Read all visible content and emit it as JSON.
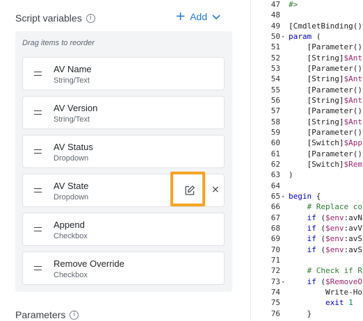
{
  "script_variables": {
    "title": "Script variables",
    "info_icon": "i",
    "add_label": "Add",
    "drag_hint": "Drag items to reorder",
    "items": [
      {
        "name": "AV Name",
        "type": "String/Text"
      },
      {
        "name": "AV Version",
        "type": "String/Text"
      },
      {
        "name": "AV Status",
        "type": "Dropdown"
      },
      {
        "name": "AV State",
        "type": "Dropdown"
      },
      {
        "name": "Append",
        "type": "Checkbox"
      },
      {
        "name": "Remove Override",
        "type": "Checkbox"
      }
    ],
    "close_glyph": "×"
  },
  "parameters": {
    "title": "Parameters",
    "info_icon": "i"
  },
  "editor": {
    "lines": [
      {
        "n": "47",
        "fold": "",
        "parts": [
          {
            "t": "#>",
            "c": "cm"
          }
        ]
      },
      {
        "n": "48",
        "fold": "",
        "parts": []
      },
      {
        "n": "49",
        "fold": "",
        "parts": [
          {
            "t": "[CmdletBinding()",
            "c": ""
          }
        ]
      },
      {
        "n": "50",
        "fold": "▾",
        "parts": [
          {
            "t": "param",
            "c": "kw"
          },
          {
            "t": " (",
            "c": ""
          }
        ]
      },
      {
        "n": "51",
        "fold": "",
        "parts": [
          {
            "t": "    [Parameter()",
            "c": ""
          }
        ]
      },
      {
        "n": "52",
        "fold": "",
        "parts": [
          {
            "t": "    [String]",
            "c": ""
          },
          {
            "t": "$Ant",
            "c": "var"
          }
        ]
      },
      {
        "n": "53",
        "fold": "",
        "parts": [
          {
            "t": "    [Parameter()",
            "c": ""
          }
        ]
      },
      {
        "n": "54",
        "fold": "",
        "parts": [
          {
            "t": "    [String]",
            "c": ""
          },
          {
            "t": "$Ant",
            "c": "var"
          }
        ]
      },
      {
        "n": "55",
        "fold": "",
        "parts": [
          {
            "t": "    [Parameter()",
            "c": ""
          }
        ]
      },
      {
        "n": "56",
        "fold": "",
        "parts": [
          {
            "t": "    [String]",
            "c": ""
          },
          {
            "t": "$Ant",
            "c": "var"
          }
        ]
      },
      {
        "n": "57",
        "fold": "",
        "parts": [
          {
            "t": "    [Parameter()",
            "c": ""
          }
        ]
      },
      {
        "n": "58",
        "fold": "",
        "parts": [
          {
            "t": "    [String]",
            "c": ""
          },
          {
            "t": "$Ant",
            "c": "var"
          }
        ]
      },
      {
        "n": "59",
        "fold": "",
        "parts": [
          {
            "t": "    [Parameter()",
            "c": ""
          }
        ]
      },
      {
        "n": "60",
        "fold": "",
        "parts": [
          {
            "t": "    [Switch]",
            "c": ""
          },
          {
            "t": "$App",
            "c": "var"
          }
        ]
      },
      {
        "n": "61",
        "fold": "",
        "parts": [
          {
            "t": "    [Parameter()",
            "c": ""
          }
        ]
      },
      {
        "n": "62",
        "fold": "",
        "parts": [
          {
            "t": "    [Switch]",
            "c": ""
          },
          {
            "t": "$Rem",
            "c": "var"
          }
        ]
      },
      {
        "n": "63",
        "fold": "",
        "parts": [
          {
            "t": ")",
            "c": ""
          }
        ]
      },
      {
        "n": "64",
        "fold": "",
        "parts": []
      },
      {
        "n": "65",
        "fold": "▾",
        "parts": [
          {
            "t": "begin",
            "c": "kw"
          },
          {
            "t": " {",
            "c": ""
          }
        ]
      },
      {
        "n": "66",
        "fold": "",
        "parts": [
          {
            "t": "    # Replace co",
            "c": "cm"
          }
        ]
      },
      {
        "n": "67",
        "fold": "",
        "parts": [
          {
            "t": "    ",
            "c": ""
          },
          {
            "t": "if",
            "c": "kw"
          },
          {
            "t": " (",
            "c": ""
          },
          {
            "t": "$env",
            "c": "var"
          },
          {
            "t": ":avN",
            "c": ""
          }
        ]
      },
      {
        "n": "68",
        "fold": "",
        "parts": [
          {
            "t": "    ",
            "c": ""
          },
          {
            "t": "if",
            "c": "kw"
          },
          {
            "t": " (",
            "c": ""
          },
          {
            "t": "$env",
            "c": "var"
          },
          {
            "t": ":avV",
            "c": ""
          }
        ]
      },
      {
        "n": "69",
        "fold": "",
        "parts": [
          {
            "t": "    ",
            "c": ""
          },
          {
            "t": "if",
            "c": "kw"
          },
          {
            "t": " (",
            "c": ""
          },
          {
            "t": "$env",
            "c": "var"
          },
          {
            "t": ":avS",
            "c": ""
          }
        ]
      },
      {
        "n": "70",
        "fold": "",
        "parts": [
          {
            "t": "    ",
            "c": ""
          },
          {
            "t": "if",
            "c": "kw"
          },
          {
            "t": " (",
            "c": ""
          },
          {
            "t": "$env",
            "c": "var"
          },
          {
            "t": ":avS",
            "c": ""
          }
        ]
      },
      {
        "n": "71",
        "fold": "",
        "parts": []
      },
      {
        "n": "72",
        "fold": "",
        "parts": [
          {
            "t": "    # Check if R",
            "c": "cm"
          }
        ]
      },
      {
        "n": "73",
        "fold": "▾",
        "parts": [
          {
            "t": "    ",
            "c": ""
          },
          {
            "t": "if",
            "c": "kw"
          },
          {
            "t": " (",
            "c": ""
          },
          {
            "t": "$RemoveO",
            "c": "var"
          }
        ]
      },
      {
        "n": "74",
        "fold": "",
        "parts": [
          {
            "t": "        Write-Ho",
            "c": ""
          }
        ]
      },
      {
        "n": "75",
        "fold": "",
        "parts": [
          {
            "t": "        ",
            "c": ""
          },
          {
            "t": "exit",
            "c": "kw"
          },
          {
            "t": " ",
            "c": ""
          },
          {
            "t": "1",
            "c": "num"
          }
        ]
      },
      {
        "n": "76",
        "fold": "",
        "parts": [
          {
            "t": "    }",
            "c": ""
          }
        ]
      }
    ]
  },
  "colors": {
    "accent": "#1f7ad1",
    "highlight": "#f5a623"
  }
}
